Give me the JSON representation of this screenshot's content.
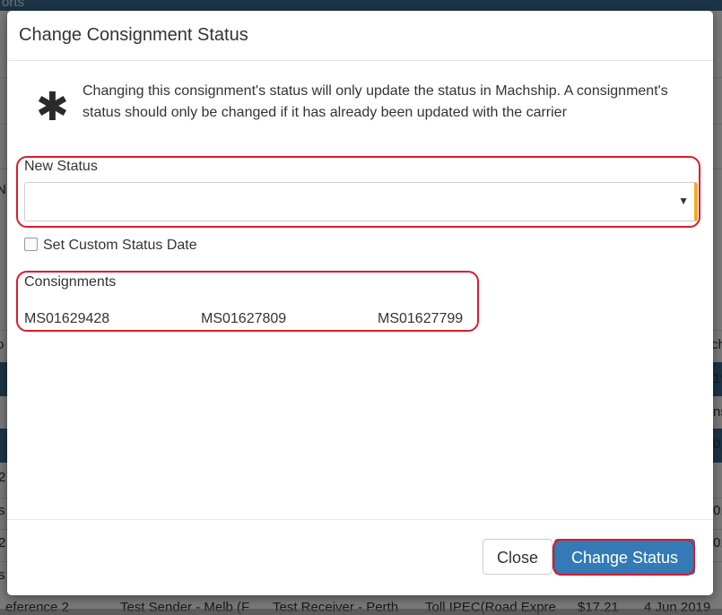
{
  "background": {
    "top_text": "orts",
    "row_texts": [
      "N",
      "o",
      "ch",
      "19",
      "ns",
      "01",
      "2",
      "s",
      "01",
      "01",
      "2",
      "s"
    ],
    "bottom_row": [
      "eference 2",
      "Test Sender - Melb (F",
      "Test Receiver - Perth",
      "Toll IPEC(Road Expre",
      "$17.21",
      "4 Jun 2019"
    ]
  },
  "modal": {
    "title": "Change Consignment Status",
    "notice_icon": "asterisk-icon",
    "notice": "Changing this consignment's status will only update the status in Machship. A consignment's status should only be changed if it has already been updated with the carrier",
    "new_status_label": "New Status",
    "new_status_value": "",
    "dropdown_icon": "caret-down-icon",
    "custom_date_label": "Set Custom Status Date",
    "custom_date_checked": false,
    "consignments_label": "Consignments",
    "consignments": [
      "MS01629428",
      "MS01627809",
      "MS01627799"
    ],
    "close_label": "Close",
    "change_status_label": "Change Status",
    "colors": {
      "primary": "#337ab7",
      "highlight": "#e0192a",
      "select_accent": "#f0ad1e"
    }
  }
}
